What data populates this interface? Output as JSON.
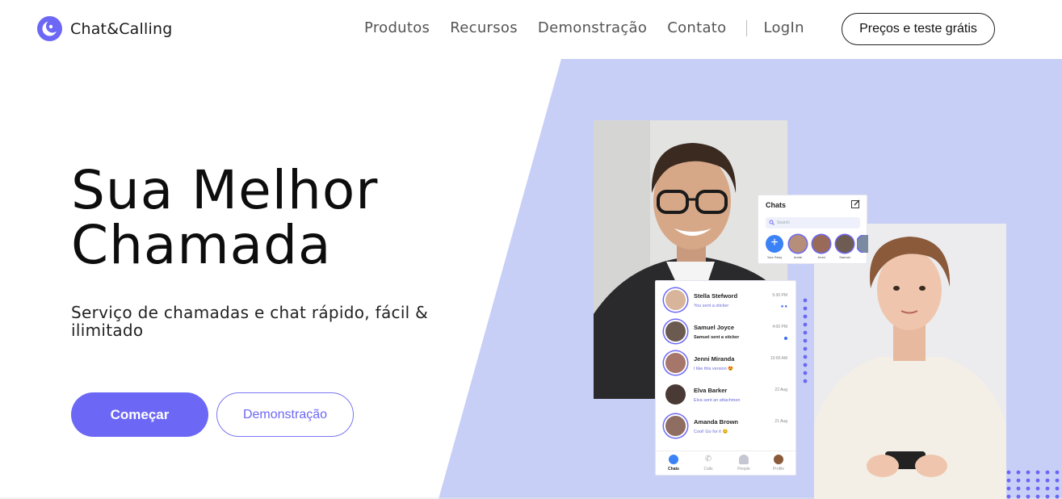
{
  "brand": {
    "name": "Chat&Calling",
    "accent": "#6c67f5",
    "logo_icon": "crescent-logo-icon"
  },
  "nav": {
    "items": [
      "Produtos",
      "Recursos",
      "Demonstração",
      "Contato"
    ],
    "login": "LogIn",
    "cta": "Preços e teste grátis"
  },
  "hero": {
    "title_line1": "Sua Melhor",
    "title_line2": "Chamada",
    "subtitle": "Serviço de chamadas e chat rápido, fácil & ilimitado",
    "primary_button": "Começar",
    "secondary_button": "Demonstração",
    "background_color": "#c8cff6"
  },
  "chats_card": {
    "title": "Chats",
    "search_placeholder": "Search",
    "stories": [
      "Your Story",
      "Annie",
      "Jenni",
      "Samuel"
    ]
  },
  "chat_list": [
    {
      "name": "Stella Stefword",
      "message": "You sent a sticker",
      "time": "5:30 PM",
      "indicator": "double-dot"
    },
    {
      "name": "Samuel Joyce",
      "message": "Samuel sent a sticker",
      "time": "4:00 PM",
      "indicator": "dot"
    },
    {
      "name": "Jenni Miranda",
      "message": "I like this version 😍",
      "time": "10:00 AM",
      "indicator": "none"
    },
    {
      "name": "Elva Barker",
      "message": "Elva sent an attachmen",
      "time": "22 Aug",
      "indicator": "none"
    },
    {
      "name": "Amanda Brown",
      "message": "Cool! Go for it 😊",
      "time": "21 Aug",
      "indicator": "none"
    }
  ],
  "tab_bar": [
    "Chats",
    "Calls",
    "People",
    "Profile"
  ]
}
